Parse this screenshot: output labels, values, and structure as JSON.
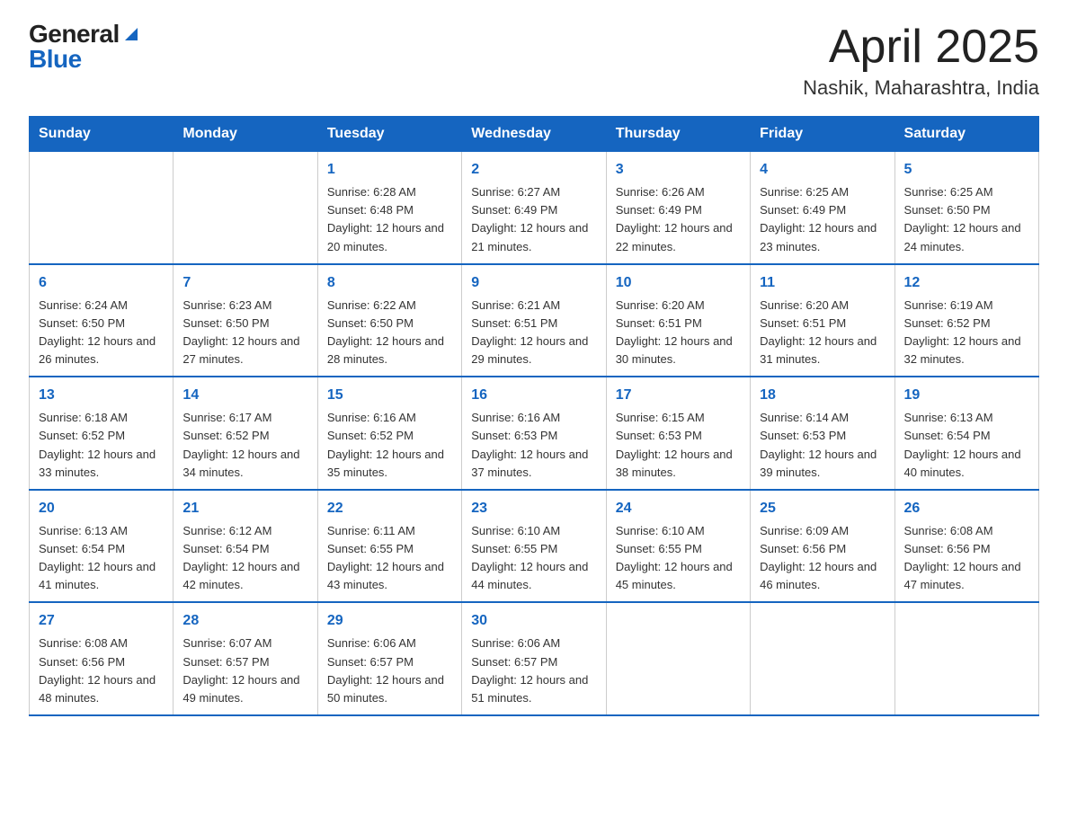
{
  "logo": {
    "general": "General",
    "blue": "Blue"
  },
  "title": "April 2025",
  "subtitle": "Nashik, Maharashtra, India",
  "days_of_week": [
    "Sunday",
    "Monday",
    "Tuesday",
    "Wednesday",
    "Thursday",
    "Friday",
    "Saturday"
  ],
  "weeks": [
    [
      {
        "day": "",
        "info": ""
      },
      {
        "day": "",
        "info": ""
      },
      {
        "day": "1",
        "info": "Sunrise: 6:28 AM\nSunset: 6:48 PM\nDaylight: 12 hours and 20 minutes."
      },
      {
        "day": "2",
        "info": "Sunrise: 6:27 AM\nSunset: 6:49 PM\nDaylight: 12 hours and 21 minutes."
      },
      {
        "day": "3",
        "info": "Sunrise: 6:26 AM\nSunset: 6:49 PM\nDaylight: 12 hours and 22 minutes."
      },
      {
        "day": "4",
        "info": "Sunrise: 6:25 AM\nSunset: 6:49 PM\nDaylight: 12 hours and 23 minutes."
      },
      {
        "day": "5",
        "info": "Sunrise: 6:25 AM\nSunset: 6:50 PM\nDaylight: 12 hours and 24 minutes."
      }
    ],
    [
      {
        "day": "6",
        "info": "Sunrise: 6:24 AM\nSunset: 6:50 PM\nDaylight: 12 hours and 26 minutes."
      },
      {
        "day": "7",
        "info": "Sunrise: 6:23 AM\nSunset: 6:50 PM\nDaylight: 12 hours and 27 minutes."
      },
      {
        "day": "8",
        "info": "Sunrise: 6:22 AM\nSunset: 6:50 PM\nDaylight: 12 hours and 28 minutes."
      },
      {
        "day": "9",
        "info": "Sunrise: 6:21 AM\nSunset: 6:51 PM\nDaylight: 12 hours and 29 minutes."
      },
      {
        "day": "10",
        "info": "Sunrise: 6:20 AM\nSunset: 6:51 PM\nDaylight: 12 hours and 30 minutes."
      },
      {
        "day": "11",
        "info": "Sunrise: 6:20 AM\nSunset: 6:51 PM\nDaylight: 12 hours and 31 minutes."
      },
      {
        "day": "12",
        "info": "Sunrise: 6:19 AM\nSunset: 6:52 PM\nDaylight: 12 hours and 32 minutes."
      }
    ],
    [
      {
        "day": "13",
        "info": "Sunrise: 6:18 AM\nSunset: 6:52 PM\nDaylight: 12 hours and 33 minutes."
      },
      {
        "day": "14",
        "info": "Sunrise: 6:17 AM\nSunset: 6:52 PM\nDaylight: 12 hours and 34 minutes."
      },
      {
        "day": "15",
        "info": "Sunrise: 6:16 AM\nSunset: 6:52 PM\nDaylight: 12 hours and 35 minutes."
      },
      {
        "day": "16",
        "info": "Sunrise: 6:16 AM\nSunset: 6:53 PM\nDaylight: 12 hours and 37 minutes."
      },
      {
        "day": "17",
        "info": "Sunrise: 6:15 AM\nSunset: 6:53 PM\nDaylight: 12 hours and 38 minutes."
      },
      {
        "day": "18",
        "info": "Sunrise: 6:14 AM\nSunset: 6:53 PM\nDaylight: 12 hours and 39 minutes."
      },
      {
        "day": "19",
        "info": "Sunrise: 6:13 AM\nSunset: 6:54 PM\nDaylight: 12 hours and 40 minutes."
      }
    ],
    [
      {
        "day": "20",
        "info": "Sunrise: 6:13 AM\nSunset: 6:54 PM\nDaylight: 12 hours and 41 minutes."
      },
      {
        "day": "21",
        "info": "Sunrise: 6:12 AM\nSunset: 6:54 PM\nDaylight: 12 hours and 42 minutes."
      },
      {
        "day": "22",
        "info": "Sunrise: 6:11 AM\nSunset: 6:55 PM\nDaylight: 12 hours and 43 minutes."
      },
      {
        "day": "23",
        "info": "Sunrise: 6:10 AM\nSunset: 6:55 PM\nDaylight: 12 hours and 44 minutes."
      },
      {
        "day": "24",
        "info": "Sunrise: 6:10 AM\nSunset: 6:55 PM\nDaylight: 12 hours and 45 minutes."
      },
      {
        "day": "25",
        "info": "Sunrise: 6:09 AM\nSunset: 6:56 PM\nDaylight: 12 hours and 46 minutes."
      },
      {
        "day": "26",
        "info": "Sunrise: 6:08 AM\nSunset: 6:56 PM\nDaylight: 12 hours and 47 minutes."
      }
    ],
    [
      {
        "day": "27",
        "info": "Sunrise: 6:08 AM\nSunset: 6:56 PM\nDaylight: 12 hours and 48 minutes."
      },
      {
        "day": "28",
        "info": "Sunrise: 6:07 AM\nSunset: 6:57 PM\nDaylight: 12 hours and 49 minutes."
      },
      {
        "day": "29",
        "info": "Sunrise: 6:06 AM\nSunset: 6:57 PM\nDaylight: 12 hours and 50 minutes."
      },
      {
        "day": "30",
        "info": "Sunrise: 6:06 AM\nSunset: 6:57 PM\nDaylight: 12 hours and 51 minutes."
      },
      {
        "day": "",
        "info": ""
      },
      {
        "day": "",
        "info": ""
      },
      {
        "day": "",
        "info": ""
      }
    ]
  ]
}
